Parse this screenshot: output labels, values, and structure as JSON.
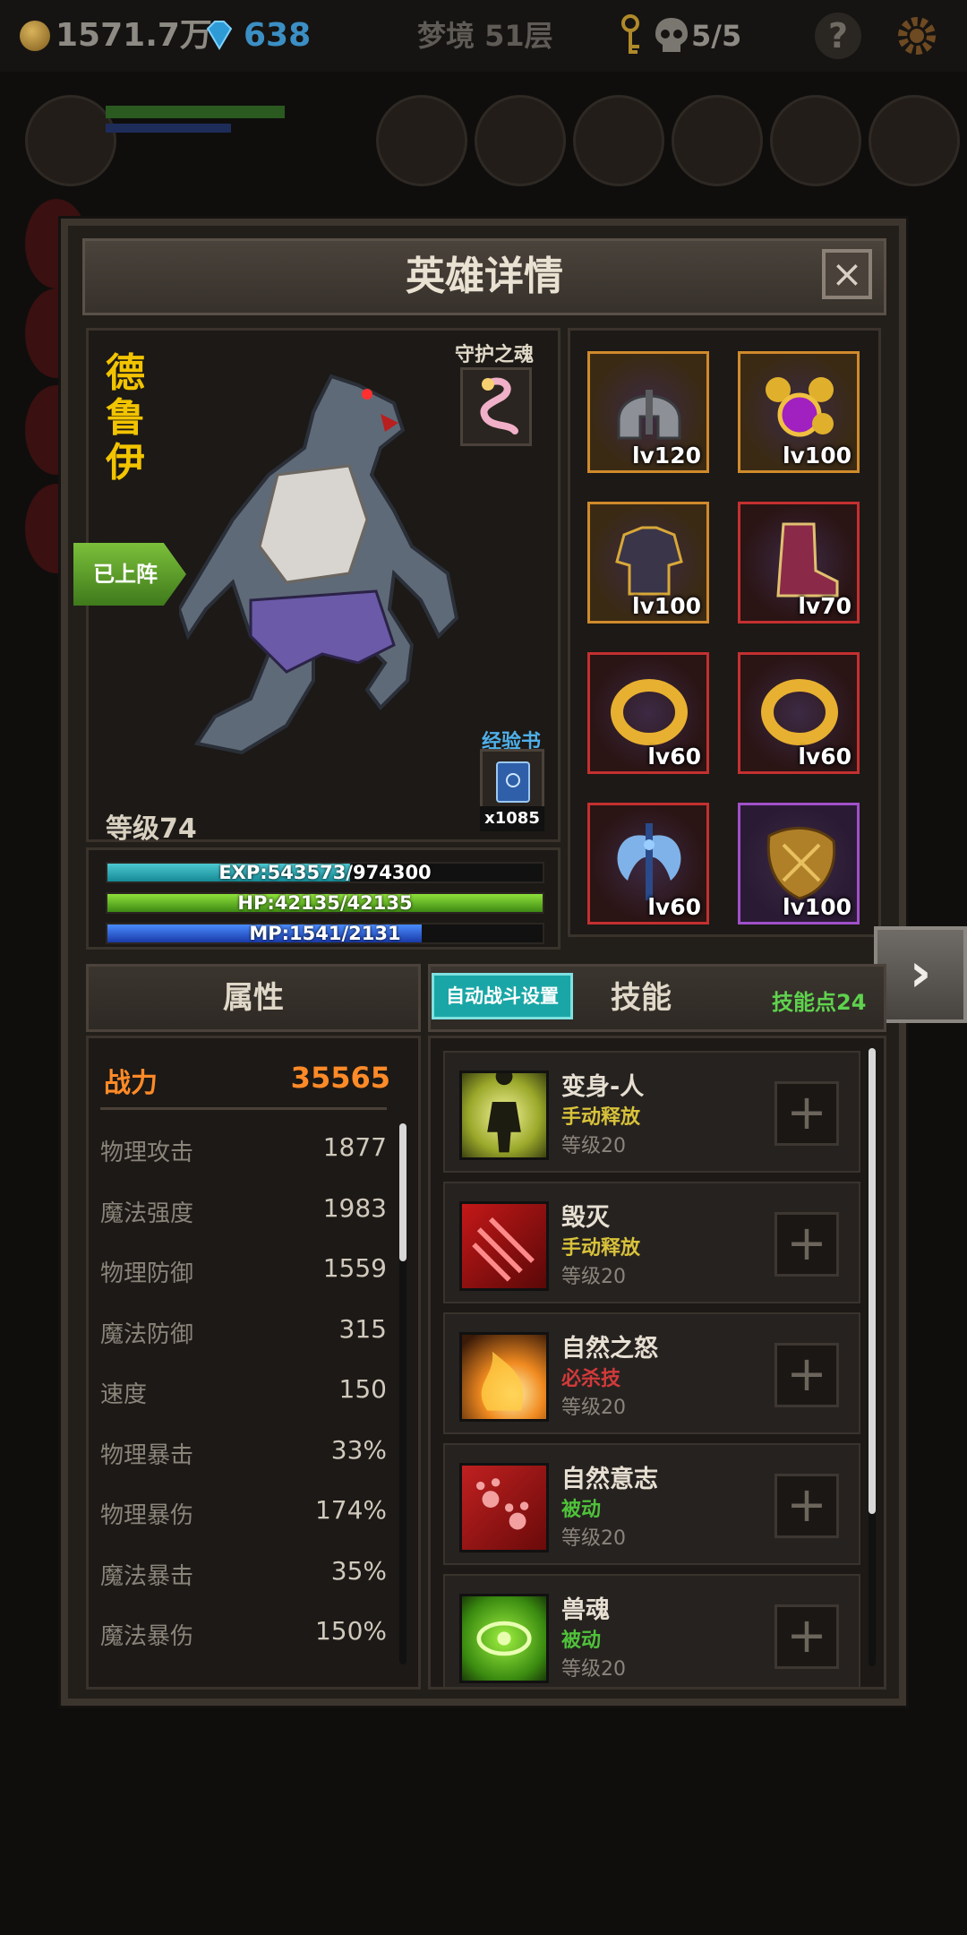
{
  "topbar": {
    "gold": "1571.7万",
    "gems": "638",
    "stage": "梦境 51层",
    "keys": "5/5",
    "help": "?"
  },
  "panel": {
    "title": "英雄详情",
    "close": "×"
  },
  "hero": {
    "name_chars": [
      "德",
      "鲁",
      "伊"
    ],
    "guard_label": "守护之魂",
    "deployed_label": "已上阵",
    "expbook_label": "经验书",
    "expbook_count": "x1085",
    "level": "等级74",
    "exp_text": "EXP:543573/974300",
    "hp_text": "HP:42135/42135",
    "mp_text": "MP:1541/2131",
    "exp_fraction": 0.558,
    "hp_fraction": 1.0,
    "mp_fraction": 0.723
  },
  "equipment": [
    {
      "name": "helmet-icon",
      "level": "lv120",
      "border": "#d08a2c"
    },
    {
      "name": "amulet-icon",
      "level": "lv100",
      "border": "#d08a2c"
    },
    {
      "name": "armor-icon",
      "level": "lv100",
      "border": "#d08a2c"
    },
    {
      "name": "boots-icon",
      "level": "lv70",
      "border": "#c43030"
    },
    {
      "name": "ring-icon",
      "level": "lv60",
      "border": "#c43030"
    },
    {
      "name": "ring-icon",
      "level": "lv60",
      "border": "#c43030"
    },
    {
      "name": "axe-icon",
      "level": "lv60",
      "border": "#c43030"
    },
    {
      "name": "shield-icon",
      "level": "lv100",
      "border": "#a050c8"
    }
  ],
  "attributes": {
    "tab_label": "属性",
    "power_label": "战力",
    "power_value": "35565",
    "rows": [
      {
        "name": "物理攻击",
        "value": "1877"
      },
      {
        "name": "魔法强度",
        "value": "1983"
      },
      {
        "name": "物理防御",
        "value": "1559"
      },
      {
        "name": "魔法防御",
        "value": "315"
      },
      {
        "name": "速度",
        "value": "150"
      },
      {
        "name": "物理暴击",
        "value": "33%"
      },
      {
        "name": "物理暴伤",
        "value": "174%"
      },
      {
        "name": "魔法暴击",
        "value": "35%"
      },
      {
        "name": "魔法暴伤",
        "value": "150%"
      }
    ]
  },
  "skills": {
    "auto_battle_label": "自动战斗设置",
    "tab_label": "技能",
    "points": "技能点24",
    "plus": "+",
    "list": [
      {
        "name": "变身-人",
        "type": "手动释放",
        "type_color": "#d8c23a",
        "level": "等级20",
        "icon": "transform-icon"
      },
      {
        "name": "毁灭",
        "type": "手动释放",
        "type_color": "#d8c23a",
        "level": "等级20",
        "icon": "claw-icon"
      },
      {
        "name": "自然之怒",
        "type": "必杀技",
        "type_color": "#d23a3a",
        "level": "等级20",
        "icon": "fire-icon"
      },
      {
        "name": "自然意志",
        "type": "被动",
        "type_color": "#4fc23a",
        "level": "等级20",
        "icon": "paw-icon"
      },
      {
        "name": "兽魂",
        "type": "被动",
        "type_color": "#4fc23a",
        "level": "等级20",
        "icon": "beast-soul-icon"
      }
    ]
  }
}
